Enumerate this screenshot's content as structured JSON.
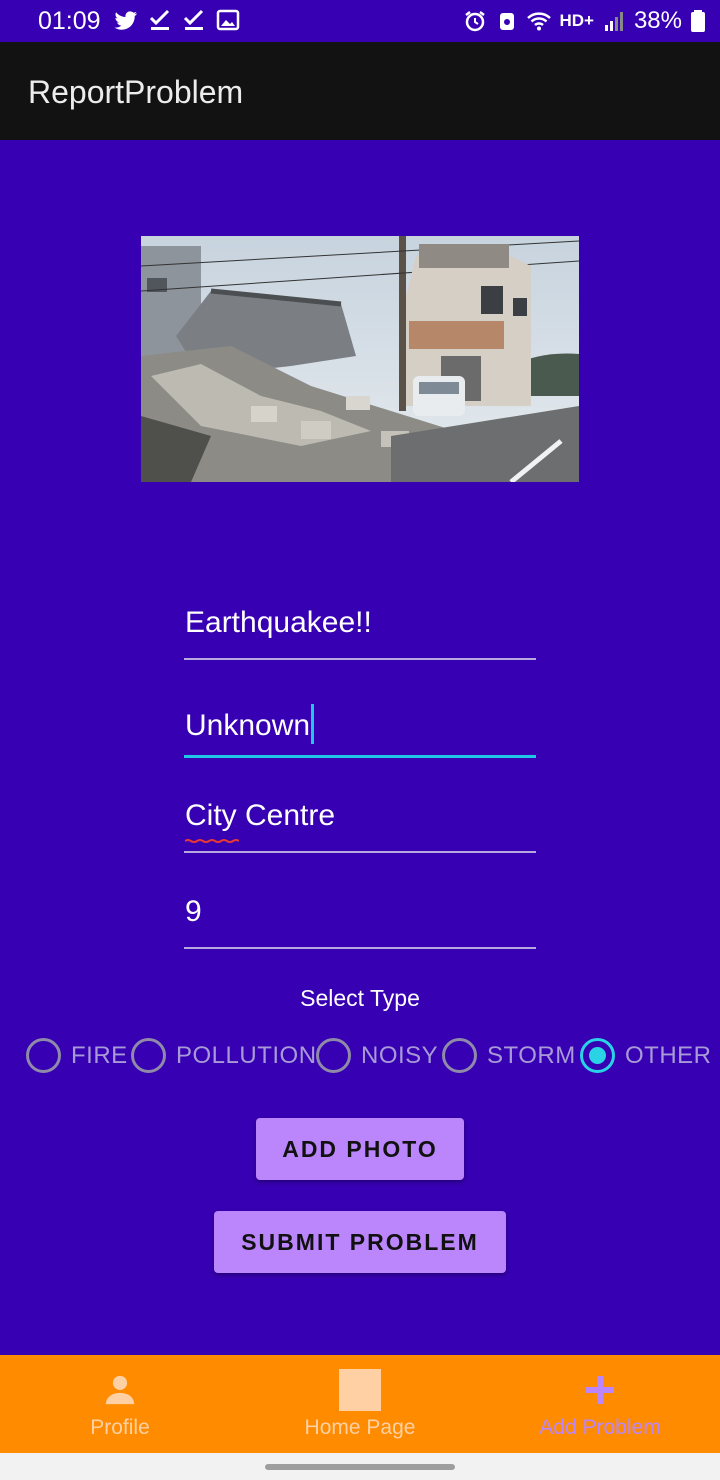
{
  "status_bar": {
    "time": "01:09",
    "network": "HD+",
    "battery": "38%"
  },
  "app_bar": {
    "title": "ReportProblem"
  },
  "form": {
    "title_value": "Earthquakee!!",
    "description_value": "Unknown",
    "location_value": "City Centre",
    "number_value": "9",
    "select_type_label": "Select Type",
    "types": [
      {
        "label": "FIRE",
        "checked": false
      },
      {
        "label": "POLLUTION",
        "checked": false
      },
      {
        "label": "NOISY",
        "checked": false
      },
      {
        "label": "STORM",
        "checked": false
      },
      {
        "label": "OTHER",
        "checked": true
      }
    ],
    "add_photo_label": "ADD PHOTO",
    "submit_label": "SUBMIT PROBLEM"
  },
  "bottom_nav": {
    "items": [
      {
        "label": "Profile",
        "icon": "person-icon",
        "active": false
      },
      {
        "label": "Home Page",
        "icon": "home-square-icon",
        "active": false
      },
      {
        "label": "Add Problem",
        "icon": "plus-icon",
        "active": true
      }
    ]
  },
  "colors": {
    "background": "#3700b3",
    "app_bar": "#121212",
    "accent": "#bb86fc",
    "focus": "#22c7e8",
    "bottom_nav": "#ff8c00"
  }
}
